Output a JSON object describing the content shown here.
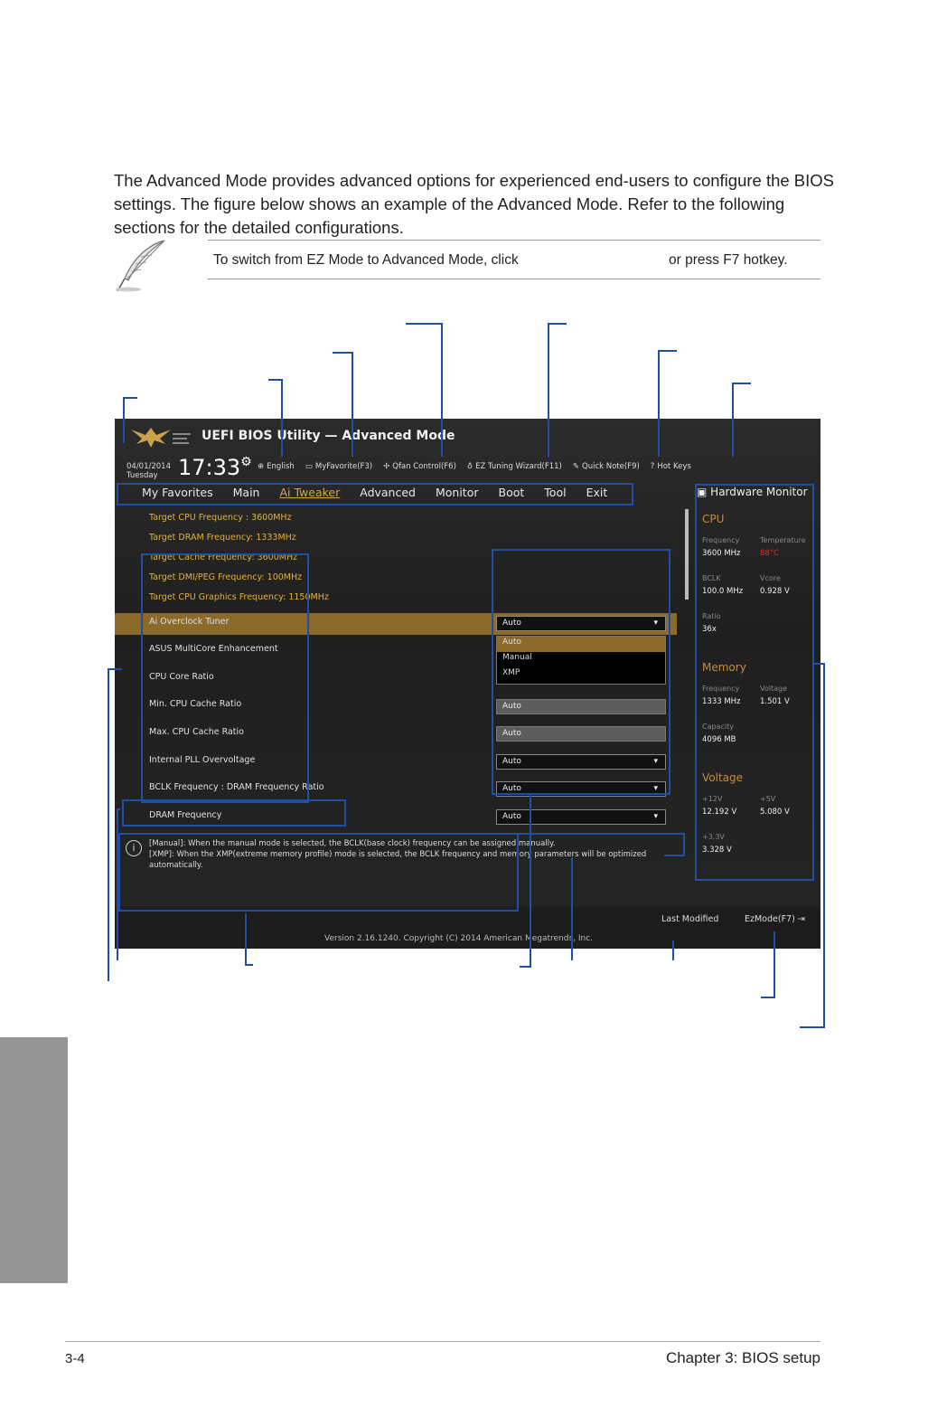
{
  "intro_text": "The Advanced Mode provides advanced options for experienced end-users to configure the BIOS settings. The figure below shows an example of the Advanced Mode. Refer to the following sections for the detailed configurations.",
  "note": {
    "text_before": "To switch from EZ Mode to Advanced Mode, click",
    "text_after": "or press F7 hotkey.",
    "icon": "feather-pen-icon"
  },
  "bios": {
    "title": "UEFI BIOS Utility — Advanced Mode",
    "date": "04/01/2014",
    "day": "Tuesday",
    "time": "17:33",
    "toolbar": {
      "language": "English",
      "myfavorite": "MyFavorite(F3)",
      "qfan": "Qfan Control(F6)",
      "ez_tuning": "EZ Tuning Wizard(F11)",
      "quick_note": "Quick Note(F9)",
      "hot_keys": "Hot Keys"
    },
    "tabs": [
      "My Favorites",
      "Main",
      "Ai Tweaker",
      "Advanced",
      "Monitor",
      "Boot",
      "Tool",
      "Exit"
    ],
    "targets": [
      "Target CPU Frequency : 3600MHz",
      "Target DRAM Frequency: 1333MHz",
      "Target Cache Frequency: 3600MHz",
      "Target DMI/PEG Frequency: 100MHz",
      "Target CPU Graphics Frequency: 1150MHz"
    ],
    "items": [
      {
        "label": "Ai Overclock Tuner",
        "value": "Auto"
      },
      {
        "label": "ASUS MultiCore Enhancement",
        "value": ""
      },
      {
        "label": "CPU Core Ratio",
        "value": ""
      },
      {
        "label": "Min. CPU Cache Ratio",
        "value": "Auto"
      },
      {
        "label": "Max. CPU Cache Ratio",
        "value": "Auto"
      },
      {
        "label": "Internal PLL Overvoltage",
        "value": "Auto"
      },
      {
        "label": "BCLK Frequency : DRAM Frequency Ratio",
        "value": "Auto"
      },
      {
        "label": "DRAM Frequency",
        "value": "Auto"
      }
    ],
    "dropdown_options": [
      "Auto",
      "Manual",
      "XMP"
    ],
    "info_lines": [
      "[Manual]: When the manual mode is selected, the BCLK(base clock) frequency can be assigned manually.",
      "[XMP]: When the XMP(extreme memory profile) mode is selected, the BCLK frequency and memory parameters will be optimized",
      "automatically."
    ],
    "hw_monitor": {
      "title": "Hardware Monitor",
      "cpu": {
        "heading": "CPU",
        "frequency_label": "Frequency",
        "frequency": "3600 MHz",
        "temperature_label": "Temperature",
        "temperature": "88°C",
        "bclk_label": "BCLK",
        "bclk": "100.0 MHz",
        "vcore_label": "Vcore",
        "vcore": "0.928 V",
        "ratio_label": "Ratio",
        "ratio": "36x"
      },
      "memory": {
        "heading": "Memory",
        "frequency_label": "Frequency",
        "frequency": "1333 MHz",
        "voltage_label": "Voltage",
        "voltage": "1.501 V",
        "capacity_label": "Capacity",
        "capacity": "4096 MB"
      },
      "voltage": {
        "heading": "Voltage",
        "v12_label": "+12V",
        "v12": "12.192 V",
        "v5_label": "+5V",
        "v5": "5.080 V",
        "v33_label": "+3.3V",
        "v33": "3.328 V"
      }
    },
    "last_modified": "Last Modified",
    "ezmode": "EzMode(F7)",
    "version": "Version 2.16.1240. Copyright (C) 2014 American Megatrends, Inc."
  },
  "colors": {
    "callout": "#1f4ea3",
    "accent_gold": "#e3b236",
    "highlight_row": "#8c6a2a",
    "temperature_red": "#e23030"
  },
  "footer": {
    "page_number": "3-4",
    "chapter": "Chapter 3: BIOS setup"
  }
}
